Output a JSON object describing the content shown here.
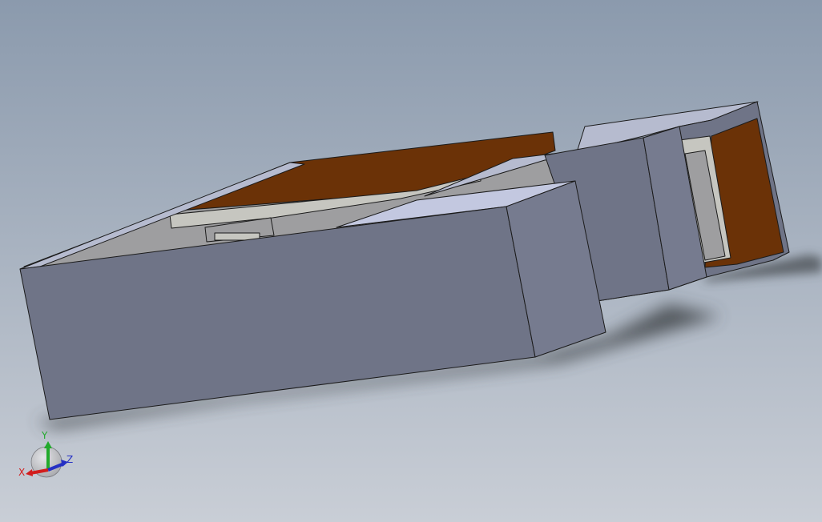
{
  "viewport": {
    "background_top": "#8b9aad",
    "background_bottom": "#c9ced6"
  },
  "model": {
    "body_front_color": "#6f7487",
    "body_side_color": "#767b8f",
    "body_top_color": "#b6bbcf",
    "highlight_top_color": "#c3c8e0",
    "interior_wall_color": "#6b3207",
    "interior_floor_color": "#9e9ea0",
    "interior_light_color": "#c6c6c0",
    "edge_color": "#1b1b1b",
    "shadow_color": "#43464c"
  },
  "triad": {
    "x_label": "X",
    "y_label": "Y",
    "z_label": "Z",
    "x_color": "#d21d1d",
    "y_color": "#22aa2c",
    "z_color": "#2530c4",
    "sphere_color": "#a8a9ad"
  }
}
